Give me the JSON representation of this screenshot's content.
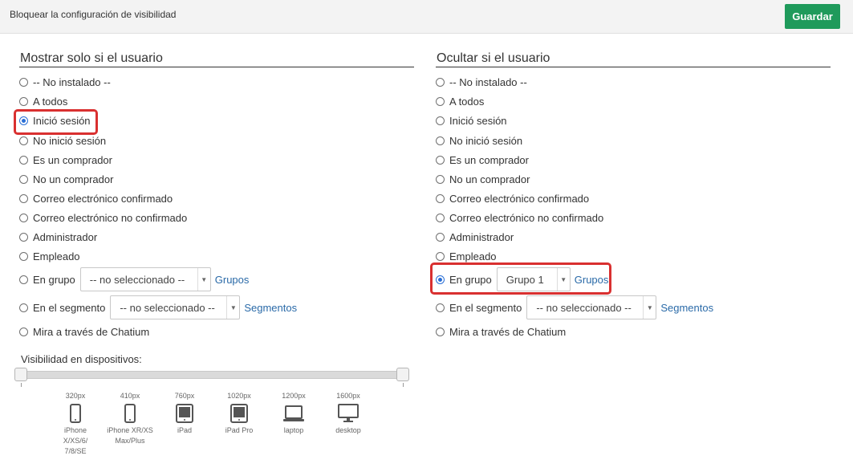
{
  "header": {
    "title": "Bloquear la configuración de visibilidad",
    "save_label": "Guardar"
  },
  "left": {
    "title": "Mostrar solo si el usuario",
    "options": [
      "-- No instalado --",
      "A todos",
      "Inició sesión",
      "No inició sesión",
      "Es un comprador",
      "No un comprador",
      "Correo electrónico confirmado",
      "Correo electrónico no confirmado",
      "Administrador",
      "Empleado"
    ],
    "selected": "Inició sesión",
    "group_label": "En grupo",
    "group_select": "-- no seleccionado --",
    "group_link": "Grupos",
    "segment_label": "En el segmento",
    "segment_select": "-- no seleccionado --",
    "segment_link": "Segmentos",
    "chatium_label": "Mira a través de Chatium"
  },
  "right": {
    "title": "Ocultar si el usuario",
    "options": [
      "-- No instalado --",
      "A todos",
      "Inició sesión",
      "No inició sesión",
      "Es un comprador",
      "No un comprador",
      "Correo electrónico confirmado",
      "Correo electrónico no confirmado",
      "Administrador",
      "Empleado"
    ],
    "selected": "En grupo",
    "group_label": "En grupo",
    "group_select": "Grupo 1",
    "group_link": "Grupos",
    "segment_label": "En el segmento",
    "segment_select": "-- no seleccionado --",
    "segment_link": "Segmentos",
    "chatium_label": "Mira a través de Chatium"
  },
  "devices": {
    "title": "Visibilidad en dispositivos:",
    "range": [
      "320px",
      "1600px"
    ],
    "items": [
      {
        "px": "320px",
        "name": "iPhone X/XS/6/ 7/8/SE",
        "icon": "phone-icon"
      },
      {
        "px": "410px",
        "name": "iPhone XR/XS Max/Plus",
        "icon": "phone-icon"
      },
      {
        "px": "760px",
        "name": "iPad",
        "icon": "tablet-icon"
      },
      {
        "px": "1020px",
        "name": "iPad Pro",
        "icon": "tablet-icon"
      },
      {
        "px": "1200px",
        "name": "laptop",
        "icon": "laptop-icon"
      },
      {
        "px": "1600px",
        "name": "desktop",
        "icon": "desktop-icon"
      }
    ]
  },
  "colors": {
    "accent": "#1f9a5b",
    "link": "#2a6aa8",
    "highlight": "#d93030",
    "radio": "#2a6fd6"
  }
}
